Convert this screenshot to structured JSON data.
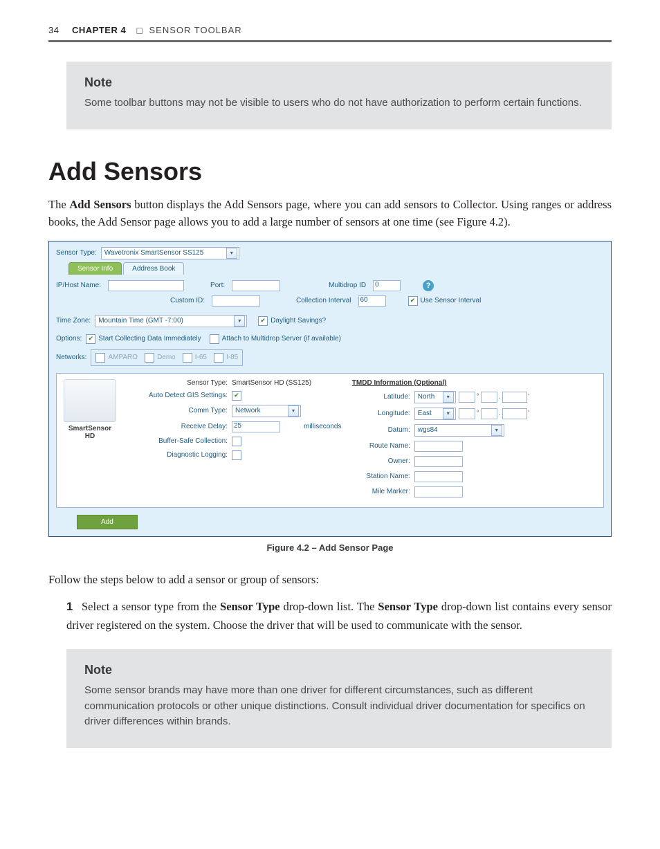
{
  "header": {
    "page_number": "34",
    "chapter_label": "CHAPTER 4",
    "separator": "◻",
    "chapter_title": "SENSOR TOOLBAR"
  },
  "note1": {
    "title": "Note",
    "body": "Some toolbar buttons may not be visible to users who do not have authorization to perform certain functions."
  },
  "h1": "Add Sensors",
  "intro": "The Add Sensors button displays the Add Sensors page, where you can add sensors to Collector. Using ranges or address books, the Add Sensor page allows you to add a large number of sensors at one time (see Figure 4.2).",
  "shot": {
    "sensor_type_label": "Sensor Type:",
    "sensor_type_value": "Wavetronix SmartSensor SS125",
    "tabs": {
      "sensor_info": "Sensor Info",
      "address_book": "Address Book"
    },
    "ip_label": "IP/Host Name:",
    "port_label": "Port:",
    "multidrop_label": "Multidrop ID",
    "multidrop_value": "0",
    "custom_id_label": "Custom ID:",
    "collection_interval_label": "Collection Interval",
    "collection_interval_value": "60",
    "use_sensor_interval": "Use Sensor Interval",
    "time_zone_label": "Time Zone:",
    "time_zone_value": "Mountain Time (GMT -7:00)",
    "daylight": "Daylight Savings?",
    "options_label": "Options:",
    "opt_start": "Start Collecting Data Immediately",
    "opt_attach": "Attach to Multidrop Server (if available)",
    "networks_label": "Networks:",
    "networks": [
      "AMPARO",
      "Demo",
      "I-65",
      "I-85"
    ],
    "panel": {
      "sensor_type_row_label": "Sensor Type:",
      "sensor_type_row_value": "SmartSensor HD (SS125)",
      "auto_detect_label": "Auto Detect GIS Settings:",
      "comm_type_label": "Comm Type:",
      "comm_type_value": "Network",
      "receive_delay_label": "Receive Delay:",
      "receive_delay_value": "25",
      "receive_delay_unit": "milliseconds",
      "buffer_safe_label": "Buffer-Safe Collection:",
      "diag_log_label": "Diagnostic Logging:",
      "thumb_line1": "SmartSensor",
      "thumb_line2": "HD"
    },
    "tmdd": {
      "title": "TMDD Information (Optional)",
      "latitude": "Latitude:",
      "lat_dir": "North",
      "longitude": "Longitude:",
      "lon_dir": "East",
      "datum": "Datum:",
      "datum_value": "wgs84",
      "route_name": "Route Name:",
      "owner": "Owner:",
      "station_name": "Station Name:",
      "mile_marker": "Mile Marker:"
    },
    "add_button": "Add"
  },
  "caption": "Figure 4.2 – Add Sensor Page",
  "follow": "Follow the steps below to add a sensor or group of sensors:",
  "step1_num": "1",
  "step1_a": "Select a sensor type from the ",
  "step1_b": "Sensor Type",
  "step1_c": " drop-down list. The ",
  "step1_d": "Sensor Type",
  "step1_e": " drop-down list contains every sensor driver registered on the system. Choose the driver that will be used to communicate with the sensor.",
  "note2": {
    "title": "Note",
    "body": "Some sensor brands may have more than one driver for different circumstances, such as different communication protocols or other unique distinctions. Consult individual driver documentation for specifics on driver differences within brands."
  }
}
